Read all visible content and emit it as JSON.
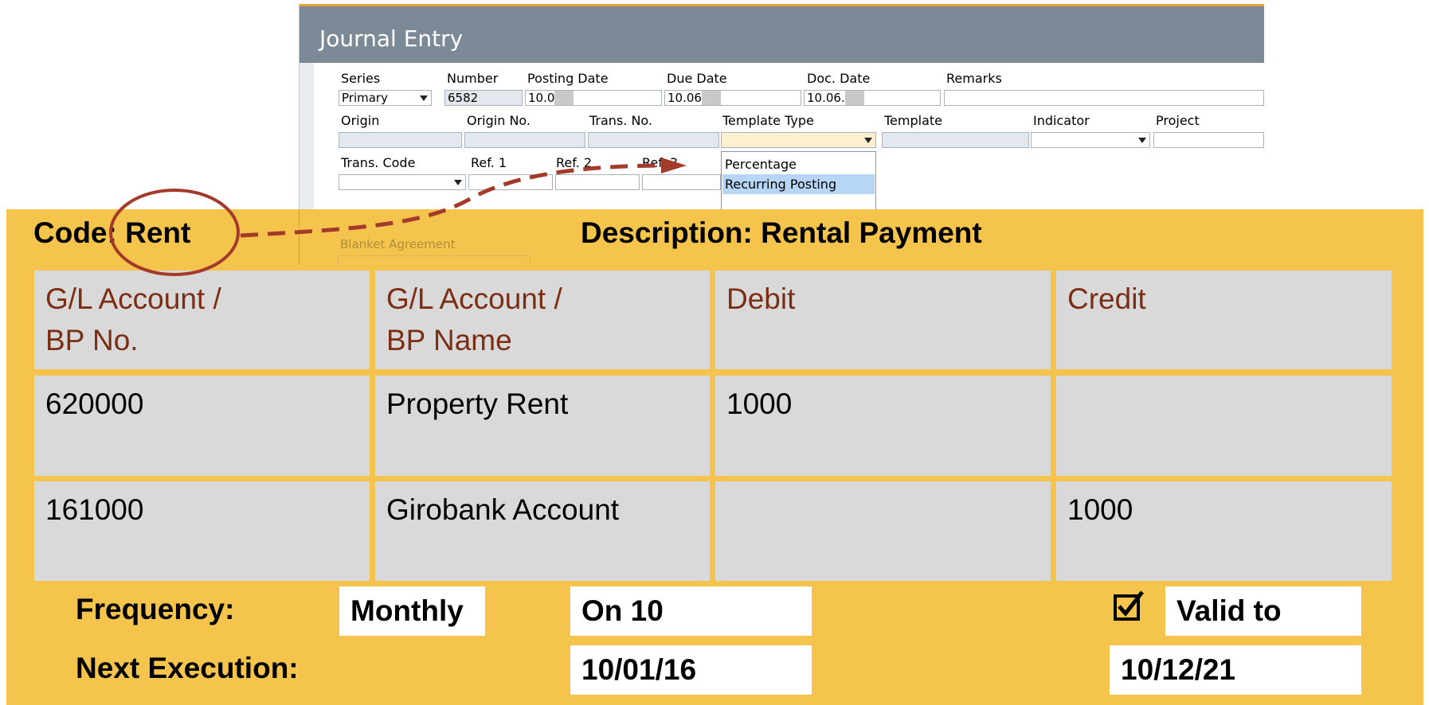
{
  "window": {
    "title": "Journal Entry",
    "row1": {
      "labels": [
        "Series",
        "Number",
        "Posting Date",
        "Due Date",
        "Doc. Date",
        "Remarks"
      ],
      "series_value": "Primary",
      "number_value": "6582",
      "posting_date_value": "10.0",
      "due_date_value": "10.06",
      "doc_date_value": "10.06."
    },
    "row2": {
      "labels": [
        "Origin",
        "Origin No.",
        "Trans. No.",
        "Template Type",
        "Template",
        "Indicator",
        "Project"
      ]
    },
    "row3": {
      "labels": [
        "Trans. Code",
        "Ref. 1",
        "Ref. 2",
        "Ref. 3"
      ]
    },
    "template_type_options": [
      "Percentage",
      "Recurring Posting"
    ],
    "template_type_selected": "Recurring Posting",
    "blanket_agreement_label": "Blanket Agreement"
  },
  "panel": {
    "code_label": "Code: Rent",
    "description_label": "Description: Rental Payment",
    "table": {
      "headers": [
        "G/L Account /\nBP No.",
        "G/L Account /\nBP Name",
        "Debit",
        "Credit"
      ],
      "rows": [
        [
          "620000",
          "Property Rent",
          "1000",
          ""
        ],
        [
          "161000",
          "Girobank Account",
          "",
          "1000"
        ]
      ]
    },
    "frequency_label": "Frequency:",
    "frequency_value": "Monthly",
    "frequency_day": "On 10",
    "valid_to_checked": true,
    "valid_to_label": "Valid to",
    "next_execution_label": "Next Execution:",
    "next_execution_value": "10/01/16",
    "valid_to_value": "10/12/21"
  },
  "colors": {
    "panel_bg": "#f4c44c",
    "titlebar_bg": "#7c8a98",
    "header_text": "#7b2e14",
    "annotation": "#a33a2a"
  }
}
